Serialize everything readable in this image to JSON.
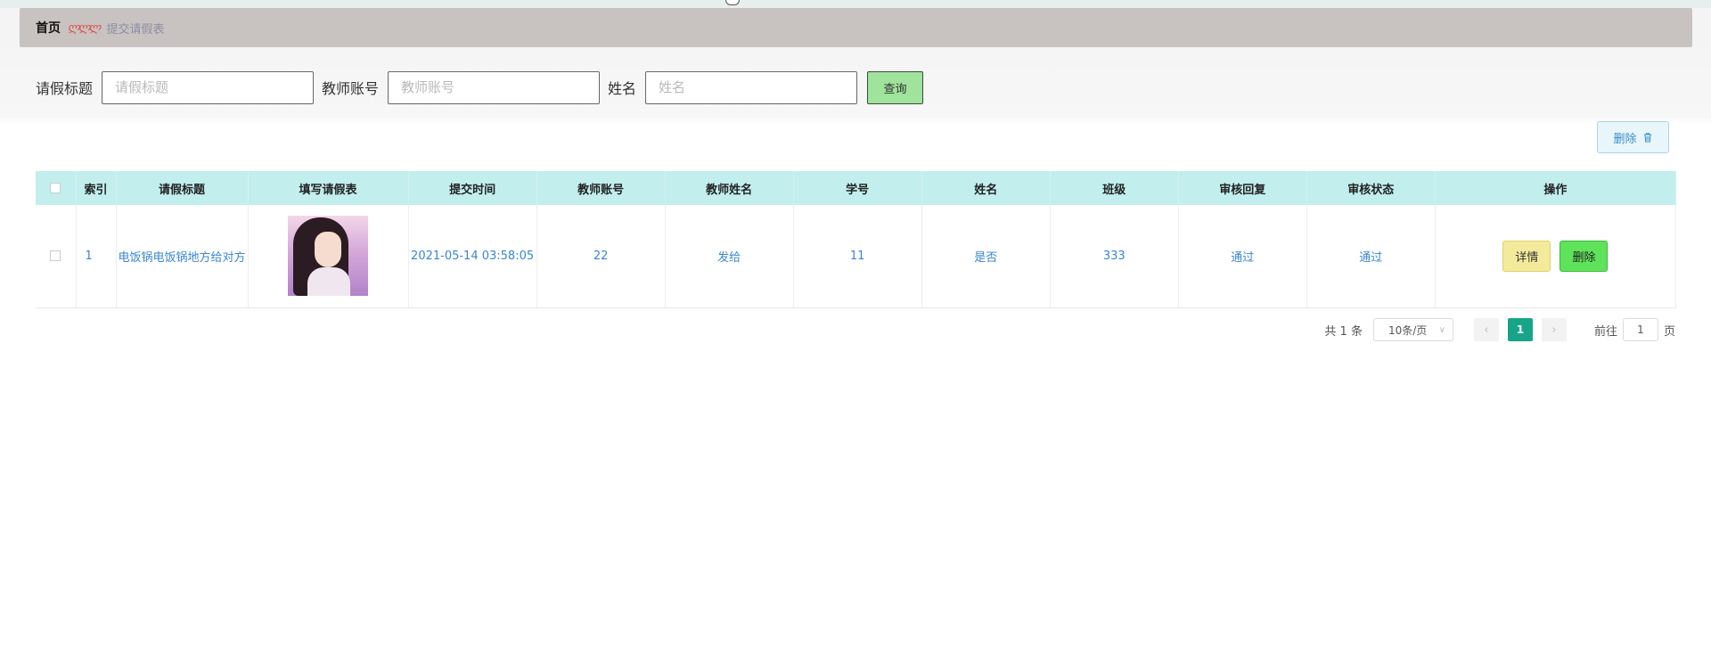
{
  "breadcrumb": {
    "home": "首页",
    "separator": "ლლლ",
    "current": "提交请假表"
  },
  "search": {
    "fields": [
      {
        "label": "请假标题",
        "placeholder": "请假标题"
      },
      {
        "label": "教师账号",
        "placeholder": "教师账号"
      },
      {
        "label": "姓名",
        "placeholder": "姓名"
      }
    ],
    "query_button": "查询"
  },
  "toolbar": {
    "batch_delete": "删除"
  },
  "table": {
    "columns": [
      "索引",
      "请假标题",
      "填写请假表",
      "提交时间",
      "教师账号",
      "教师姓名",
      "学号",
      "姓名",
      "班级",
      "审核回复",
      "审核状态",
      "操作"
    ],
    "rows": [
      {
        "index": "1",
        "title": "电饭锅电饭锅地方给对方",
        "submit_time": "2021-05-14 03:58:05",
        "teacher_account": "22",
        "teacher_name": "发给",
        "student_id": "11",
        "name": "是否",
        "class": "333",
        "review_reply": "通过",
        "review_status": "通过",
        "detail_button": "详情",
        "delete_button": "删除"
      }
    ]
  },
  "pagination": {
    "total": "共 1 条",
    "page_size": "10条/页",
    "current_page": "1",
    "goto_prefix": "前往",
    "goto_value": "1",
    "goto_suffix": "页"
  },
  "colors": {
    "header_bg": "#c2eeee",
    "link": "#3a86d0",
    "query_button": "#9fe39c",
    "detail_button": "#f3ea9c",
    "delete_button": "#5fe35a",
    "active_page": "#17a589"
  }
}
